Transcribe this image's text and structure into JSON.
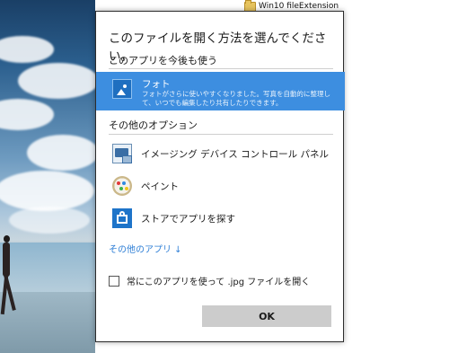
{
  "desktop": {
    "file_name": "Win10 fileExtension"
  },
  "dialog": {
    "title": "このファイルを開く方法を選んでください。",
    "section_keep": "このアプリを今後も使う",
    "selected_app": {
      "name": "フォト",
      "description": "フォトがさらに使いやすくなりました。写真を自動的に整理して、いつでも編集したり共有したりできます。",
      "icon": "photos-icon"
    },
    "section_other": "その他のオプション",
    "other_apps": [
      {
        "name": "イメージング デバイス コントロール パネル",
        "icon": "imaging-devices-icon"
      },
      {
        "name": "ペイント",
        "icon": "paint-palette-icon"
      },
      {
        "name": "ストアでアプリを探す",
        "icon": "store-bag-icon"
      }
    ],
    "more_apps_link": "その他のアプリ ↓",
    "always_use_label": "常にこのアプリを使って .jpg ファイルを開く",
    "always_use_checked": false,
    "ok_label": "OK"
  },
  "colors": {
    "selection": "#3d8ee0",
    "link": "#2f7fd6",
    "ok_button": "#cccccc"
  }
}
